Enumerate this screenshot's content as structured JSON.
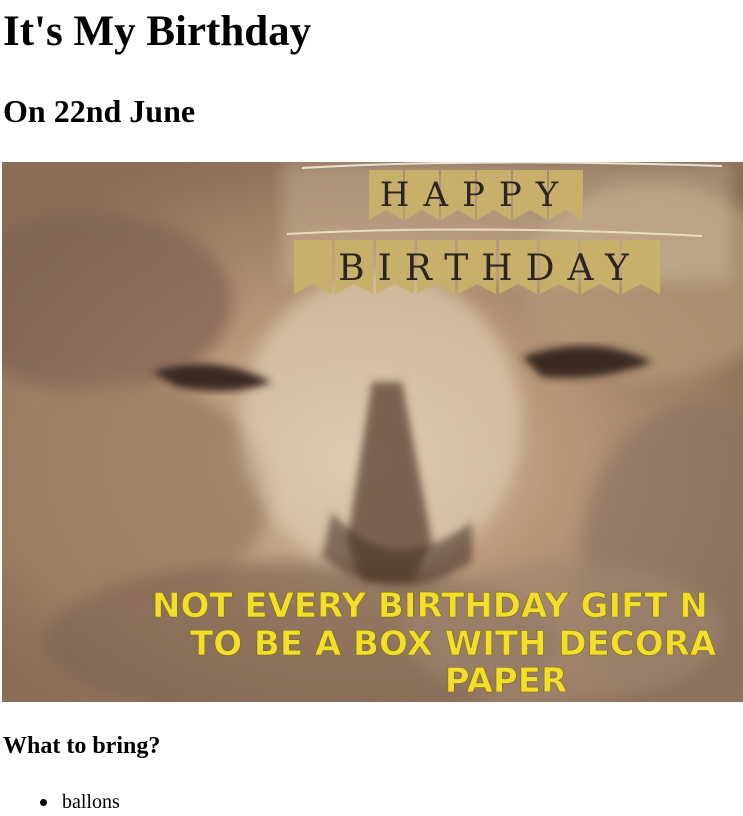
{
  "page": {
    "title": "It's My Birthday",
    "subtitle": "On 22nd June"
  },
  "hero_image": {
    "banner_top": "HAPPY",
    "banner_bottom": "BIRTHDAY",
    "caption_lines": [
      "NOT EVERY BIRTHDAY GIFT N",
      "TO BE A BOX WITH DECORA",
      "PAPER"
    ],
    "colors": {
      "fur": "#a8896c",
      "pennant": "#c9b06a",
      "caption": "#f3df2a"
    }
  },
  "bring_section": {
    "heading": "What to bring?",
    "items": [
      "ballons"
    ]
  }
}
